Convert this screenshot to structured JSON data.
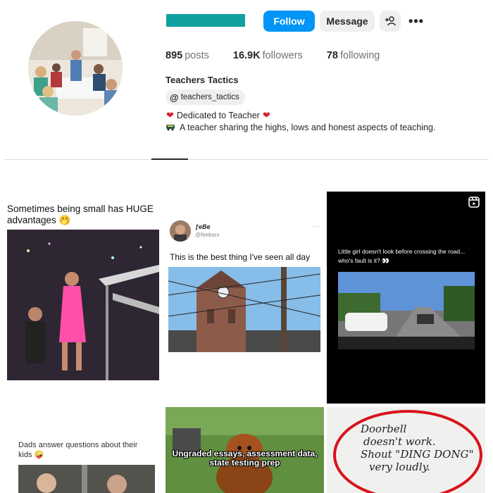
{
  "profile": {
    "follow_label": "Follow",
    "message_label": "Message",
    "more_label": "•••",
    "full_name": "Teachers Tactics",
    "threads_handle": "teachers_tactics",
    "brand_color": "#0095f6",
    "username_redaction_color": "#10a0a0"
  },
  "stats": {
    "posts_count": "895",
    "posts_label": "posts",
    "followers_count": "16.9K",
    "followers_label": "followers",
    "following_count": "78",
    "following_label": "following"
  },
  "bio": {
    "line1": "Dedicated to Teacher",
    "line2": "A teacher sharing the highs, lows and honest aspects of teaching."
  },
  "posts": [
    {
      "caption": "Sometimes being small has HUGE advantages 🤭",
      "reel": false
    },
    {
      "author_name": "ƒeBe",
      "author_handle": "@feebsrx",
      "caption": "This is the best thing I've seen all day",
      "reel": false
    },
    {
      "caption": "Little girl doesn't look before crossing the road... who's fault is it? 👀",
      "reel": true
    },
    {
      "caption": "Dads answer questions about their kids 🤪",
      "reel": false
    },
    {
      "caption": "Ungraded essays, assessment data, state testing prep",
      "reel": false
    },
    {
      "line1": "Doorbell",
      "line2": "doesn't work.",
      "line3": "Shout \"DING DONG\"",
      "line4": "very loudly.",
      "reel": false
    }
  ]
}
